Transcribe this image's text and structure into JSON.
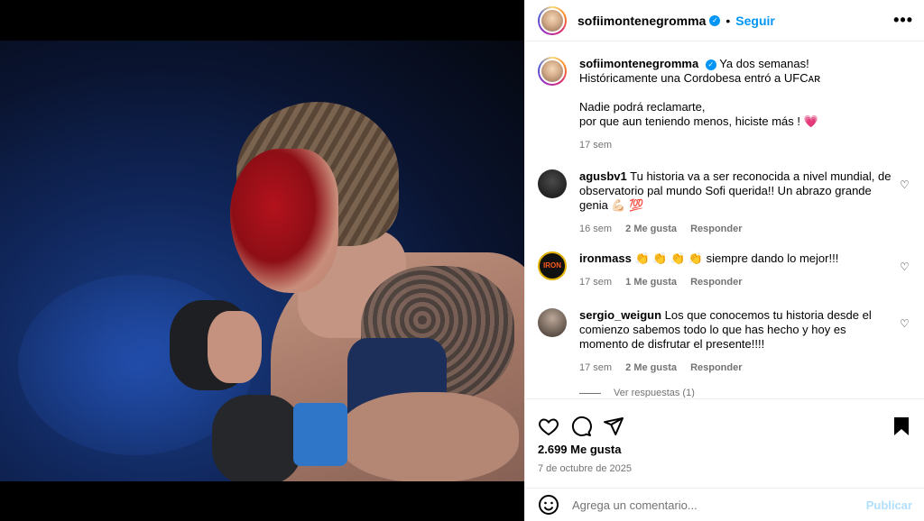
{
  "post": {
    "username": "sofiimontenegromma",
    "follow_label": "Seguir",
    "more_label": "•••"
  },
  "caption": {
    "username": "sofiimontenegromma",
    "line1": "Ya dos semanas!",
    "line2": "Históricamente una Cordobesa entró a UFCᴀʀ",
    "line3": "Nadie podrá reclamarte,",
    "line4": "por que aun teniendo menos, hiciste más ! 💗",
    "time": "17 sem"
  },
  "comments": [
    {
      "username": "agusbv1",
      "text": "Tu historia va a ser reconocida a nivel mundial, de observatorio pal mundo Sofi querida!! Un abrazo grande genia 💪🏻 💯",
      "time": "16 sem",
      "likes": "2 Me gusta",
      "reply": "Responder"
    },
    {
      "username": "ironmass",
      "text": "👏 👏 👏 👏 siempre dando lo mejor!!!",
      "time": "17 sem",
      "likes": "1 Me gusta",
      "reply": "Responder",
      "avatar_text": "IRON"
    },
    {
      "username": "sergio_weigun",
      "text": "Los que conocemos tu historia desde el comienzo sabemos todo lo que has hecho y hoy es momento de disfrutar el presente!!!!",
      "time": "17 sem",
      "likes": "2 Me gusta",
      "reply": "Responder"
    }
  ],
  "view_replies": "Ver respuestas (1)",
  "likes_count": "2.699 Me gusta",
  "date": "7 de octubre de 2025",
  "composer": {
    "placeholder": "Agrega un comentario...",
    "publish": "Publicar"
  },
  "icons": {
    "like": "heart-icon",
    "comment": "comment-icon",
    "share": "share-icon",
    "save": "bookmark-icon",
    "emoji": "emoji-icon"
  },
  "colors": {
    "accent": "#0095f6",
    "publish_disabled": "#b2dffc",
    "meta": "#737373"
  }
}
